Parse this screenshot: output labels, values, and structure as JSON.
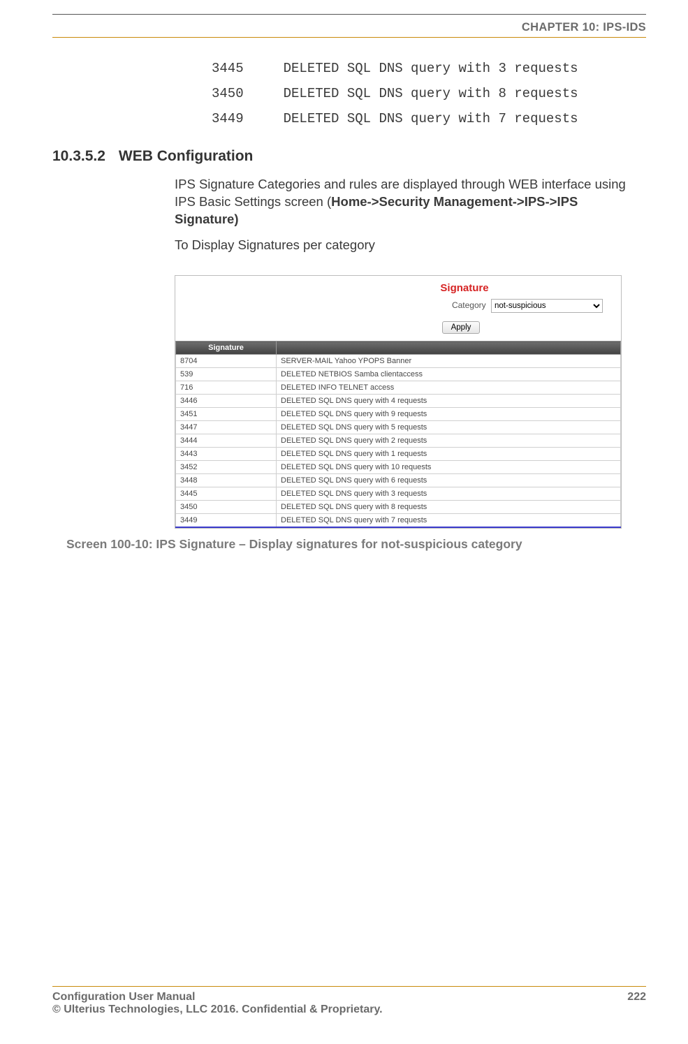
{
  "header": {
    "chapter": "CHAPTER 10: IPS-IDS"
  },
  "code_lines": [
    {
      "id": "3445",
      "text": "DELETED SQL DNS query with 3 requests"
    },
    {
      "id": "3450",
      "text": "DELETED SQL DNS query with 8 requests"
    },
    {
      "id": "3449",
      "text": "DELETED SQL DNS query with 7 requests"
    }
  ],
  "section": {
    "number": "10.3.5.2",
    "title": "WEB Configuration"
  },
  "para1": {
    "pre": "IPS Signature Categories and rules are displayed through WEB interface using IPS Basic Settings screen (",
    "bold": "Home->Security Management->IPS->IPS Signature)",
    "post": ""
  },
  "para2": "To Display Signatures per category",
  "figure": {
    "title": "Signature",
    "category_label": "Category",
    "category_value": "not-suspicious",
    "apply_label": "Apply",
    "col_header": "Signature",
    "rows": [
      {
        "id": "8704",
        "desc": "SERVER-MAIL Yahoo YPOPS Banner"
      },
      {
        "id": "539",
        "desc": "DELETED NETBIOS Samba clientaccess"
      },
      {
        "id": "716",
        "desc": "DELETED INFO TELNET access"
      },
      {
        "id": "3446",
        "desc": "DELETED SQL DNS query with 4 requests"
      },
      {
        "id": "3451",
        "desc": "DELETED SQL DNS query with 9 requests"
      },
      {
        "id": "3447",
        "desc": "DELETED SQL DNS query with 5 requests"
      },
      {
        "id": "3444",
        "desc": "DELETED SQL DNS query with 2 requests"
      },
      {
        "id": "3443",
        "desc": "DELETED SQL DNS query with 1 requests"
      },
      {
        "id": "3452",
        "desc": "DELETED SQL DNS query with 10 requests"
      },
      {
        "id": "3448",
        "desc": "DELETED SQL DNS query with 6 requests"
      },
      {
        "id": "3445",
        "desc": "DELETED SQL DNS query with 3 requests"
      },
      {
        "id": "3450",
        "desc": "DELETED SQL DNS query with 8 requests"
      },
      {
        "id": "3449",
        "desc": "DELETED SQL DNS query with 7 requests"
      }
    ]
  },
  "caption": "Screen 100-10: IPS Signature – Display signatures for not-suspicious category",
  "footer": {
    "left1": "Configuration User Manual",
    "left2": "© Ulterius Technologies, LLC 2016. Confidential & Proprietary.",
    "page": "222"
  }
}
